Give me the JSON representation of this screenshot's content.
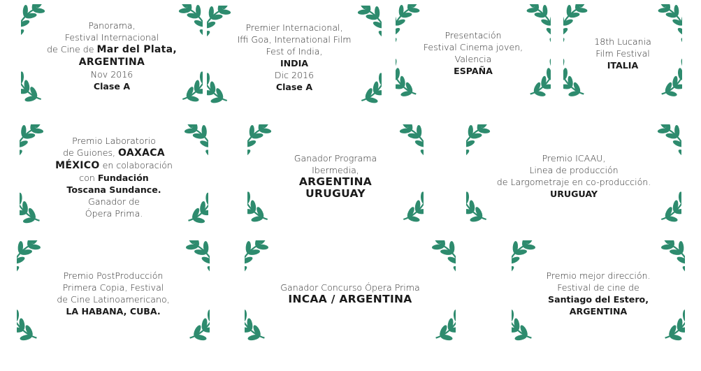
{
  "colors": {
    "laurel": "#2e8b6e"
  },
  "awards": [
    {
      "id": "mar-del-plata",
      "lines": [
        [
          {
            "t": "Panorama,"
          }
        ],
        [
          {
            "t": "Festival Internacional"
          }
        ],
        [
          {
            "t": "de Cine de "
          },
          {
            "t": "Mar del Plata,",
            "s": "b"
          }
        ],
        [
          {
            "t": "ARGENTINA",
            "s": "b"
          }
        ],
        [
          {
            "t": "Nov 2016"
          }
        ],
        [
          {
            "t": "Clase A",
            "s": "b13"
          }
        ]
      ]
    },
    {
      "id": "india",
      "lines": [
        [
          {
            "t": "Premier Internacional,"
          }
        ],
        [
          {
            "t": "Iffi Goa, International Film"
          }
        ],
        [
          {
            "t": "Fest of India,"
          }
        ],
        [
          {
            "t": "INDIA",
            "s": "b13"
          }
        ],
        [
          {
            "t": "Dic 2016"
          }
        ],
        [
          {
            "t": "Clase A",
            "s": "b13"
          }
        ]
      ]
    },
    {
      "id": "valencia",
      "lines": [
        [
          {
            "t": "Presentación"
          }
        ],
        [
          {
            "t": "Festival Cinema joven,"
          }
        ],
        [
          {
            "t": "Valencia"
          }
        ],
        [
          {
            "t": "ESPAÑA",
            "s": "b13"
          }
        ]
      ]
    },
    {
      "id": "lucania",
      "lines": [
        [
          {
            "t": "18th Lucania"
          }
        ],
        [
          {
            "t": "Film Festival"
          }
        ],
        [
          {
            "t": "ITALIA",
            "s": "b13"
          }
        ]
      ]
    },
    {
      "id": "oaxaca",
      "lines": [
        [
          {
            "t": "Premio Laboratorio"
          }
        ],
        [
          {
            "t": "de Guiones, "
          },
          {
            "t": "OAXACA",
            "s": "b"
          }
        ],
        [
          {
            "t": "MÉXICO",
            "s": "b"
          },
          {
            "t": " en colaboración"
          }
        ],
        [
          {
            "t": "con "
          },
          {
            "t": "Fundación",
            "s": "b13"
          }
        ],
        [
          {
            "t": "Toscana Sundance.",
            "s": "b13"
          }
        ],
        [
          {
            "t": "Ganador de"
          }
        ],
        [
          {
            "t": "Ópera Prima."
          }
        ]
      ]
    },
    {
      "id": "ibermedia",
      "lines": [
        [
          {
            "t": "Ganador Programa"
          }
        ],
        [
          {
            "t": "Ibermedia,"
          }
        ],
        [
          {
            "t": "ARGENTINA",
            "s": "bb"
          }
        ],
        [
          {
            "t": "URUGUAY",
            "s": "bb"
          }
        ]
      ]
    },
    {
      "id": "icaau",
      "lines": [
        [
          {
            "t": "Premio ICAAU,"
          }
        ],
        [
          {
            "t": "Linea de producción"
          }
        ],
        [
          {
            "t": "de Largometraje en co-producción."
          }
        ],
        [
          {
            "t": "URUGUAY",
            "s": "b13"
          }
        ]
      ]
    },
    {
      "id": "la-habana",
      "lines": [
        [
          {
            "t": "Premio PostProducción"
          }
        ],
        [
          {
            "t": "Primera Copia, Festival"
          }
        ],
        [
          {
            "t": "de Cine Latinoamericano,"
          }
        ],
        [
          {
            "t": "LA HABANA, CUBA.",
            "s": "b13"
          }
        ]
      ]
    },
    {
      "id": "incaa",
      "lines": [
        [
          {
            "t": "Ganador Concurso Ópera Prima"
          }
        ],
        [
          {
            "t": "INCAA / ARGENTINA",
            "s": "bb"
          }
        ]
      ]
    },
    {
      "id": "santiago-del-estero",
      "lines": [
        [
          {
            "t": "Premio mejor dirección."
          }
        ],
        [
          {
            "t": "Festival de cine de"
          }
        ],
        [
          {
            "t": "Santiago del Estero,",
            "s": "b13"
          }
        ],
        [
          {
            "t": "ARGENTINA",
            "s": "b13"
          }
        ]
      ]
    }
  ]
}
